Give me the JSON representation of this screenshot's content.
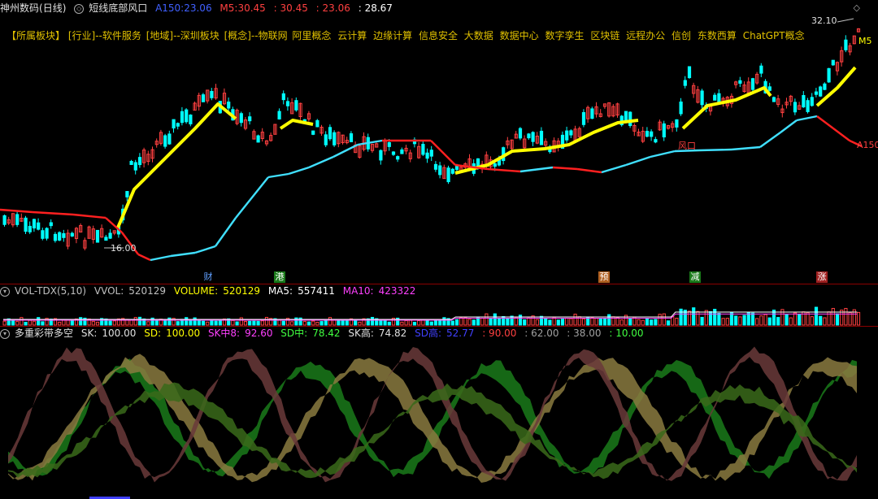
{
  "header": {
    "stock_name": "神州数码",
    "period": "(日线)",
    "formula": "短线底部风口",
    "a150_label": "A150:",
    "a150_value": "23.06",
    "m5_label": "M5:",
    "m5_value": "30.45",
    "v3": "30.45",
    "v4": "23.06",
    "v5": "28.67"
  },
  "sectors": {
    "prefix": "【所属板块】",
    "items": [
      "[行业]--软件服务",
      "[地域]--深圳板块",
      "[概念]--物联网",
      "阿里概念",
      "云计算",
      "边缘计算",
      "信息安全",
      "大数据",
      "数据中心",
      "数字孪生",
      "区块链",
      "远程办公",
      "信创",
      "东数西算",
      "ChatGPT概念"
    ]
  },
  "main_chart": {
    "high_label": "32.10",
    "low_label": "16.00",
    "m5_tag": "M5",
    "a150_tag": "A150",
    "fengkou_tag": "风口",
    "events": [
      "财",
      "港",
      "预",
      "减",
      "涨"
    ]
  },
  "volume": {
    "title": "VOL-TDX(5,10)",
    "vvol_label": "VVOL:",
    "vvol_value": "520129",
    "volume_label": "VOLUME:",
    "volume_value": "520129",
    "ma5_label": "MA5:",
    "ma5_value": "557411",
    "ma10_label": "MA10:",
    "ma10_value": "423322"
  },
  "indicator": {
    "title": "多重彩带多空",
    "sk_label": "SK:",
    "sk_value": "100.00",
    "sd_label": "SD:",
    "sd_value": "100.00",
    "skz_label": "SK中8:",
    "skz_value": "92.60",
    "sdz_label": "SD中:",
    "sdz_value": "78.42",
    "skg_label": "SK高:",
    "skg_value": "74.82",
    "sdg_label": "SD高:",
    "sdg_value": "52.77",
    "l90": ": 90.00",
    "l62": ": 62.00",
    "l38": ": 38.00",
    "l10": ": 10.00"
  },
  "colors": {
    "m5_line": "#ffff00",
    "a150_red": "#ff2020",
    "a150_cyan": "#40e0ff",
    "up_candle": "#ff4040",
    "down_candle": "#00ffff",
    "sk_color": "#ff40ff",
    "sd_color": "#40ff40",
    "sdg_color": "#4040ff"
  }
}
